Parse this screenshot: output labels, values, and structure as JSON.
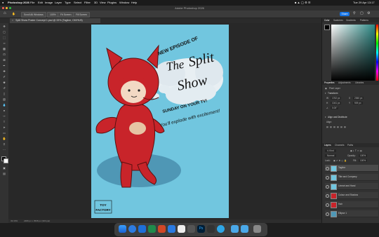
{
  "menubar": {
    "app_name": "Photoshop 2026",
    "items": [
      "File",
      "Edit",
      "Image",
      "Layer",
      "Type",
      "Select",
      "Filter",
      "3D",
      "View",
      "Plugins",
      "Window",
      "Help"
    ],
    "datetime": "Tue 29 Apr 13:17"
  },
  "titlebar": {
    "title": "Adobe Photoshop 2026"
  },
  "optbar": {
    "btn1": "Scroll All Windows",
    "btn2": "100%",
    "btn3": "Fit Screen",
    "btn4": "Fill Screen",
    "share": "Share"
  },
  "document": {
    "tab_title": "Split Show Poster Concept 1.psd @ 33% (Tagline, CMYK/8)",
    "status_zoom": "33.33%",
    "status_info": "2480 px x 3508 px (300 ppi)"
  },
  "artwork": {
    "line1": "NEW EPISODE OF",
    "logo_the": "The",
    "logo_split": "Split",
    "logo_show": "Show",
    "line_sunday": "SUNDAY ON YOUR TV!",
    "line_explode": "You'll explode with excitement!",
    "brand_line1": "TOY",
    "brand_line2": "FACTORY"
  },
  "panels": {
    "color_tabs": [
      "Color",
      "Swatches",
      "Gradients",
      "Patterns"
    ],
    "properties_tabs": [
      "Properties",
      "Adjustments",
      "Libraries"
    ],
    "pixel_layer": "Pixel Layer",
    "transform_label": "Transform",
    "w_value": "1762 px",
    "h_value": "1041 px",
    "x_value": "2360 px",
    "y_value": "909 px",
    "angle_value": "0.00°",
    "align_label": "Align and Distribute",
    "align_sub": "Align:",
    "layers_tabs": [
      "Layers",
      "Channels",
      "Paths"
    ],
    "kind_label": "Kind",
    "blend_mode": "Normal",
    "opacity_label": "Opacity:",
    "opacity_value": "100%",
    "lock_label": "Lock:",
    "fill_label": "Fill:",
    "fill_value": "100%",
    "layers": [
      "Tagline",
      "Title and Company",
      "Lineart and Hand",
      "Colour and Shadow",
      "Hair",
      "Ellipse 1"
    ]
  },
  "colors": {
    "accent": "#1473e6",
    "poster_bg": "#71c6df",
    "character_red": "#c8242a",
    "shadow": "#4f97b5"
  }
}
